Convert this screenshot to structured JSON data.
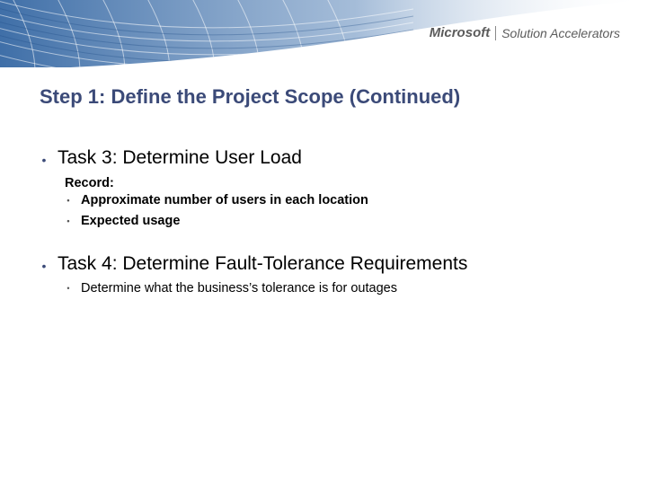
{
  "branding": {
    "company": "Microsoft",
    "product": "Solution Accelerators"
  },
  "title": "Step 1: Define the Project Scope (Continued)",
  "tasks": [
    {
      "heading": "Task 3: Determine User Load",
      "lead": "Record:",
      "items": [
        "Approximate number of users in each location",
        "Expected usage"
      ]
    },
    {
      "heading": "Task 4: Determine Fault-Tolerance Requirements",
      "lead": null,
      "items": [
        "Determine what the business’s tolerance is for outages"
      ]
    }
  ],
  "chart_data": {
    "type": "table",
    "title": "Step 1: Define the Project Scope (Continued)",
    "rows": [
      {
        "task": "Task 3: Determine User Load",
        "subhead": "Record:",
        "bullets": [
          "Approximate number of users in each location",
          "Expected usage"
        ]
      },
      {
        "task": "Task 4: Determine Fault-Tolerance Requirements",
        "subhead": null,
        "bullets": [
          "Determine what the business’s tolerance is for outages"
        ]
      }
    ]
  }
}
